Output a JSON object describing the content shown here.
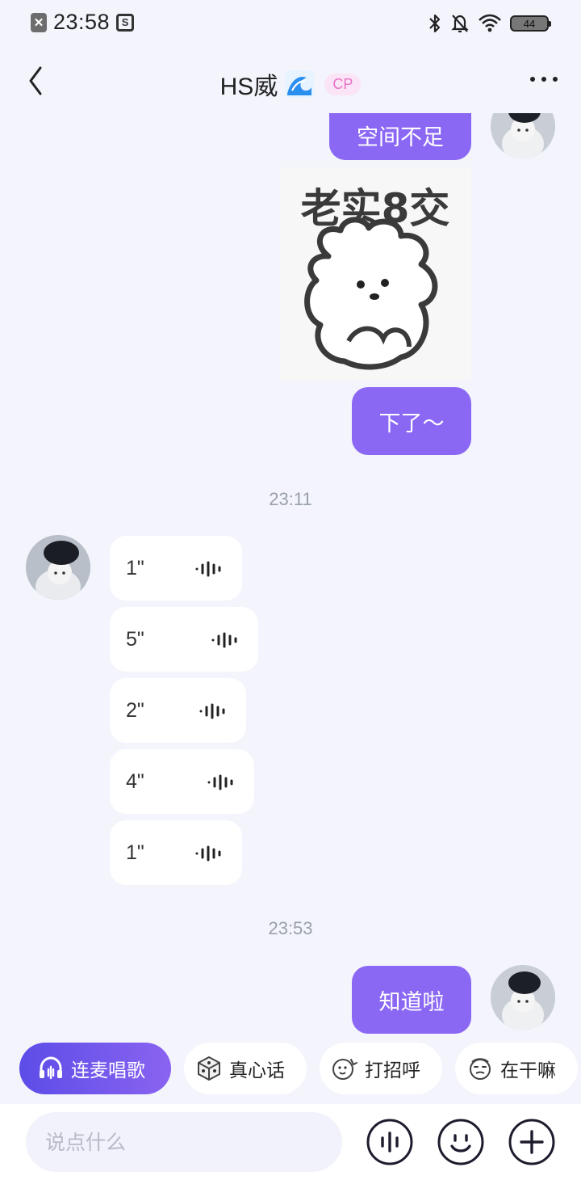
{
  "status_bar": {
    "time": "23:58",
    "battery": "44",
    "notif_icons": [
      "close-notification-icon",
      "screenshot-notification-icon"
    ],
    "right_icons": [
      "bluetooth-icon",
      "bell-off-icon",
      "wifi-icon",
      "battery-icon"
    ]
  },
  "header": {
    "title": "HS威",
    "title_emoji": "wave-emoji-icon",
    "badge": "CP"
  },
  "messages": {
    "out_space_text": "空间不足",
    "sticker_caption": "老实8交",
    "out_downloaded_text": "下了～",
    "time_1": "23:11",
    "voice_messages": [
      {
        "duration": "1\""
      },
      {
        "duration": "5\""
      },
      {
        "duration": "2\""
      },
      {
        "duration": "4\""
      },
      {
        "duration": "1\""
      }
    ],
    "time_2": "23:53",
    "out_ack_text": "知道啦"
  },
  "quick_actions": {
    "karaoke": "连麦唱歌",
    "truth": "真心话",
    "greet": "打招呼",
    "whatsup": "在干嘛"
  },
  "input": {
    "placeholder": "说点什么"
  },
  "colors": {
    "accent": "#8b68f4",
    "background": "#f3f4fc"
  }
}
